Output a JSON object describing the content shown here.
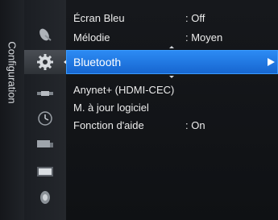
{
  "sidebar": {
    "title": "Configuration"
  },
  "menu": {
    "items_top": [
      {
        "label": "Écran Bleu",
        "value": ": Off"
      },
      {
        "label": "Mélodie",
        "value": ": Moyen"
      }
    ],
    "selected": {
      "label": "Bluetooth"
    },
    "items_bottom": [
      {
        "label": "Anynet+ (HDMI-CEC)",
        "value": ""
      },
      {
        "label": "M. à jour logiciel",
        "value": ""
      },
      {
        "label": "Fonction d'aide",
        "value": ": On"
      }
    ]
  },
  "icons": [
    "satellite-dish-icon",
    "settings-gear-icon",
    "satellite-input-icon",
    "clock-icon",
    "connection-box-icon",
    "picture-icon",
    "sound-speaker-icon"
  ],
  "colors": {
    "highlight": "#1f78e6",
    "icon_active_bg": "#3d4148",
    "text": "#ececec"
  }
}
